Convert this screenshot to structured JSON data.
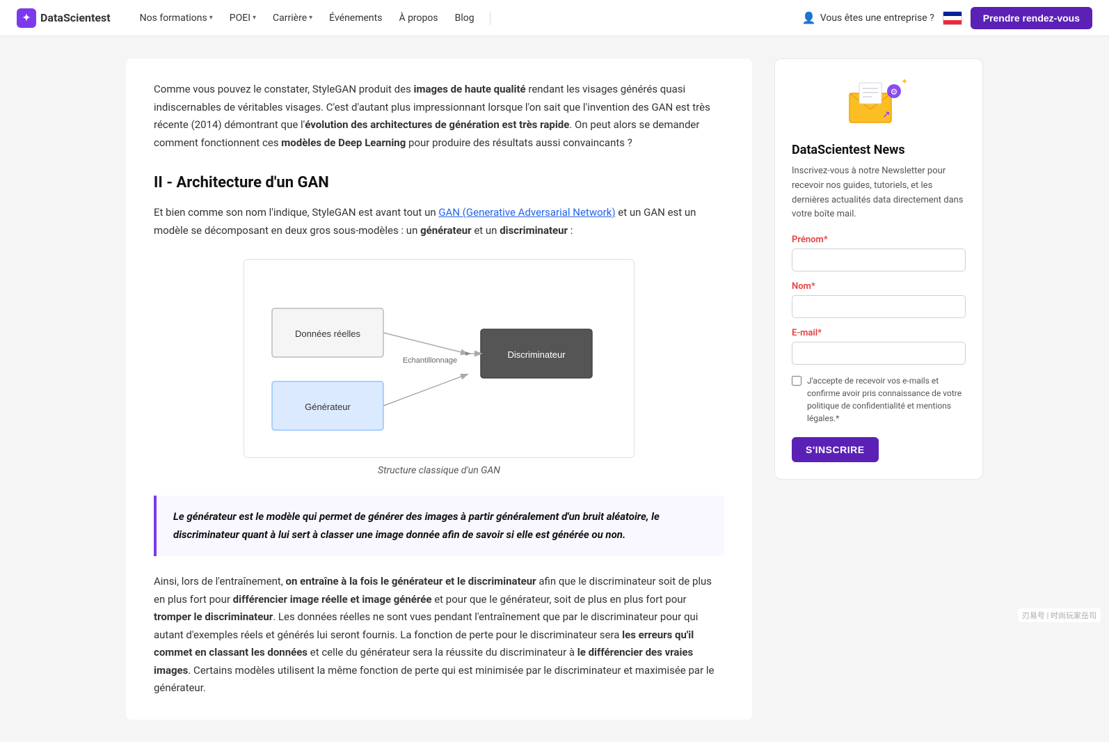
{
  "nav": {
    "logo_text": "DataScientest",
    "links": [
      {
        "label": "Nos formations",
        "has_dropdown": true
      },
      {
        "label": "POEI",
        "has_dropdown": true
      },
      {
        "label": "Carrière",
        "has_dropdown": true
      },
      {
        "label": "Événements",
        "has_dropdown": false
      },
      {
        "label": "À propos",
        "has_dropdown": false
      },
      {
        "label": "Blog",
        "has_dropdown": false
      }
    ],
    "enterprise_label": "Vous êtes une entreprise ?",
    "cta_label": "Prendre rendez-vous"
  },
  "main": {
    "intro": {
      "text1": "Comme vous pouvez le constater, StyleGAN produit des ",
      "bold1": "images de haute qualité",
      "text2": " rendant les visages générés quasi indiscernables de véritables visages. C'est d'autant plus impressionnant lorsque l'on sait que l'invention des GAN est très récente (2014) démontrant que l'",
      "bold2": "évolution des architectures de génération est très rapide",
      "text3": ". On peut alors se demander comment fonctionnent ces ",
      "bold3": "modèles de Deep Learning",
      "text4": " pour produire des résultats aussi convaincants ?"
    },
    "section2_title": "II - Architecture d'un GAN",
    "section2_intro1": "Et bien comme son nom l'indique, StyleGAN est avant tout un ",
    "section2_link": "GAN (Generative Adversarial Network)",
    "section2_intro2": " et un GAN est un modèle se décomposant en deux gros sous-modèles : un ",
    "section2_bold1": "générateur",
    "section2_intro3": " et un ",
    "section2_bold2": "discriminateur",
    "section2_intro4": " :",
    "diagram_caption": "Structure classique d'un GAN",
    "diagram": {
      "donnees_reelles": "Données réelles",
      "generateur": "Générateur",
      "echantillonnage": "Echantillonnage",
      "discriminateur": "Discriminateur"
    },
    "blockquote": "Le générateur est le modèle qui permet de générer des images à partir généralement d'un bruit aléatoire, le discriminateur quant à lui sert à classer une image donnée afin de savoir si elle est générée ou non.",
    "closing": {
      "text1": "Ainsi, lors de l'entraînement, ",
      "bold1": "on entraîne à la fois le générateur et le discriminateur",
      "text2": " afin que le discriminateur soit de plus en plus fort pour ",
      "bold2": "différencier image réelle et image générée",
      "text3": " et pour que le générateur, soit de plus en plus fort pour ",
      "bold3": "tromper le discriminateur",
      "text4": ". Les données réelles ne sont vues pendant l'entraînement que par le discriminateur pour qui autant d'exemples réels et générés lui seront fournis. La fonction de perte pour le discriminateur sera ",
      "bold4": "les erreurs qu'il commet en classant les données",
      "text5": " et celle du générateur sera la réussite du discriminateur à ",
      "bold5": "le différencier des vraies images",
      "text6": ". Certains modèles utilisent la même fonction de perte qui est minimisée par le discriminateur et maximisée par le générateur."
    }
  },
  "sidebar": {
    "title": "DataScientest News",
    "description": "Inscrivez-vous à notre Newsletter pour recevoir nos guides, tutoriels, et les dernières actualités data directement dans votre boîte mail.",
    "form": {
      "prenom_label": "Prénom",
      "prenom_placeholder": "",
      "nom_label": "Nom",
      "nom_placeholder": "",
      "email_label": "E-mail",
      "email_placeholder": "",
      "checkbox_label": "J'accepte de recevoir vos e-mails et confirme avoir pris connaissance de votre politique de confidentialité et mentions légales.",
      "submit_label": "S'INSCRIRE"
    }
  },
  "watermark": "刃易号 | 时尚玩家岳司"
}
